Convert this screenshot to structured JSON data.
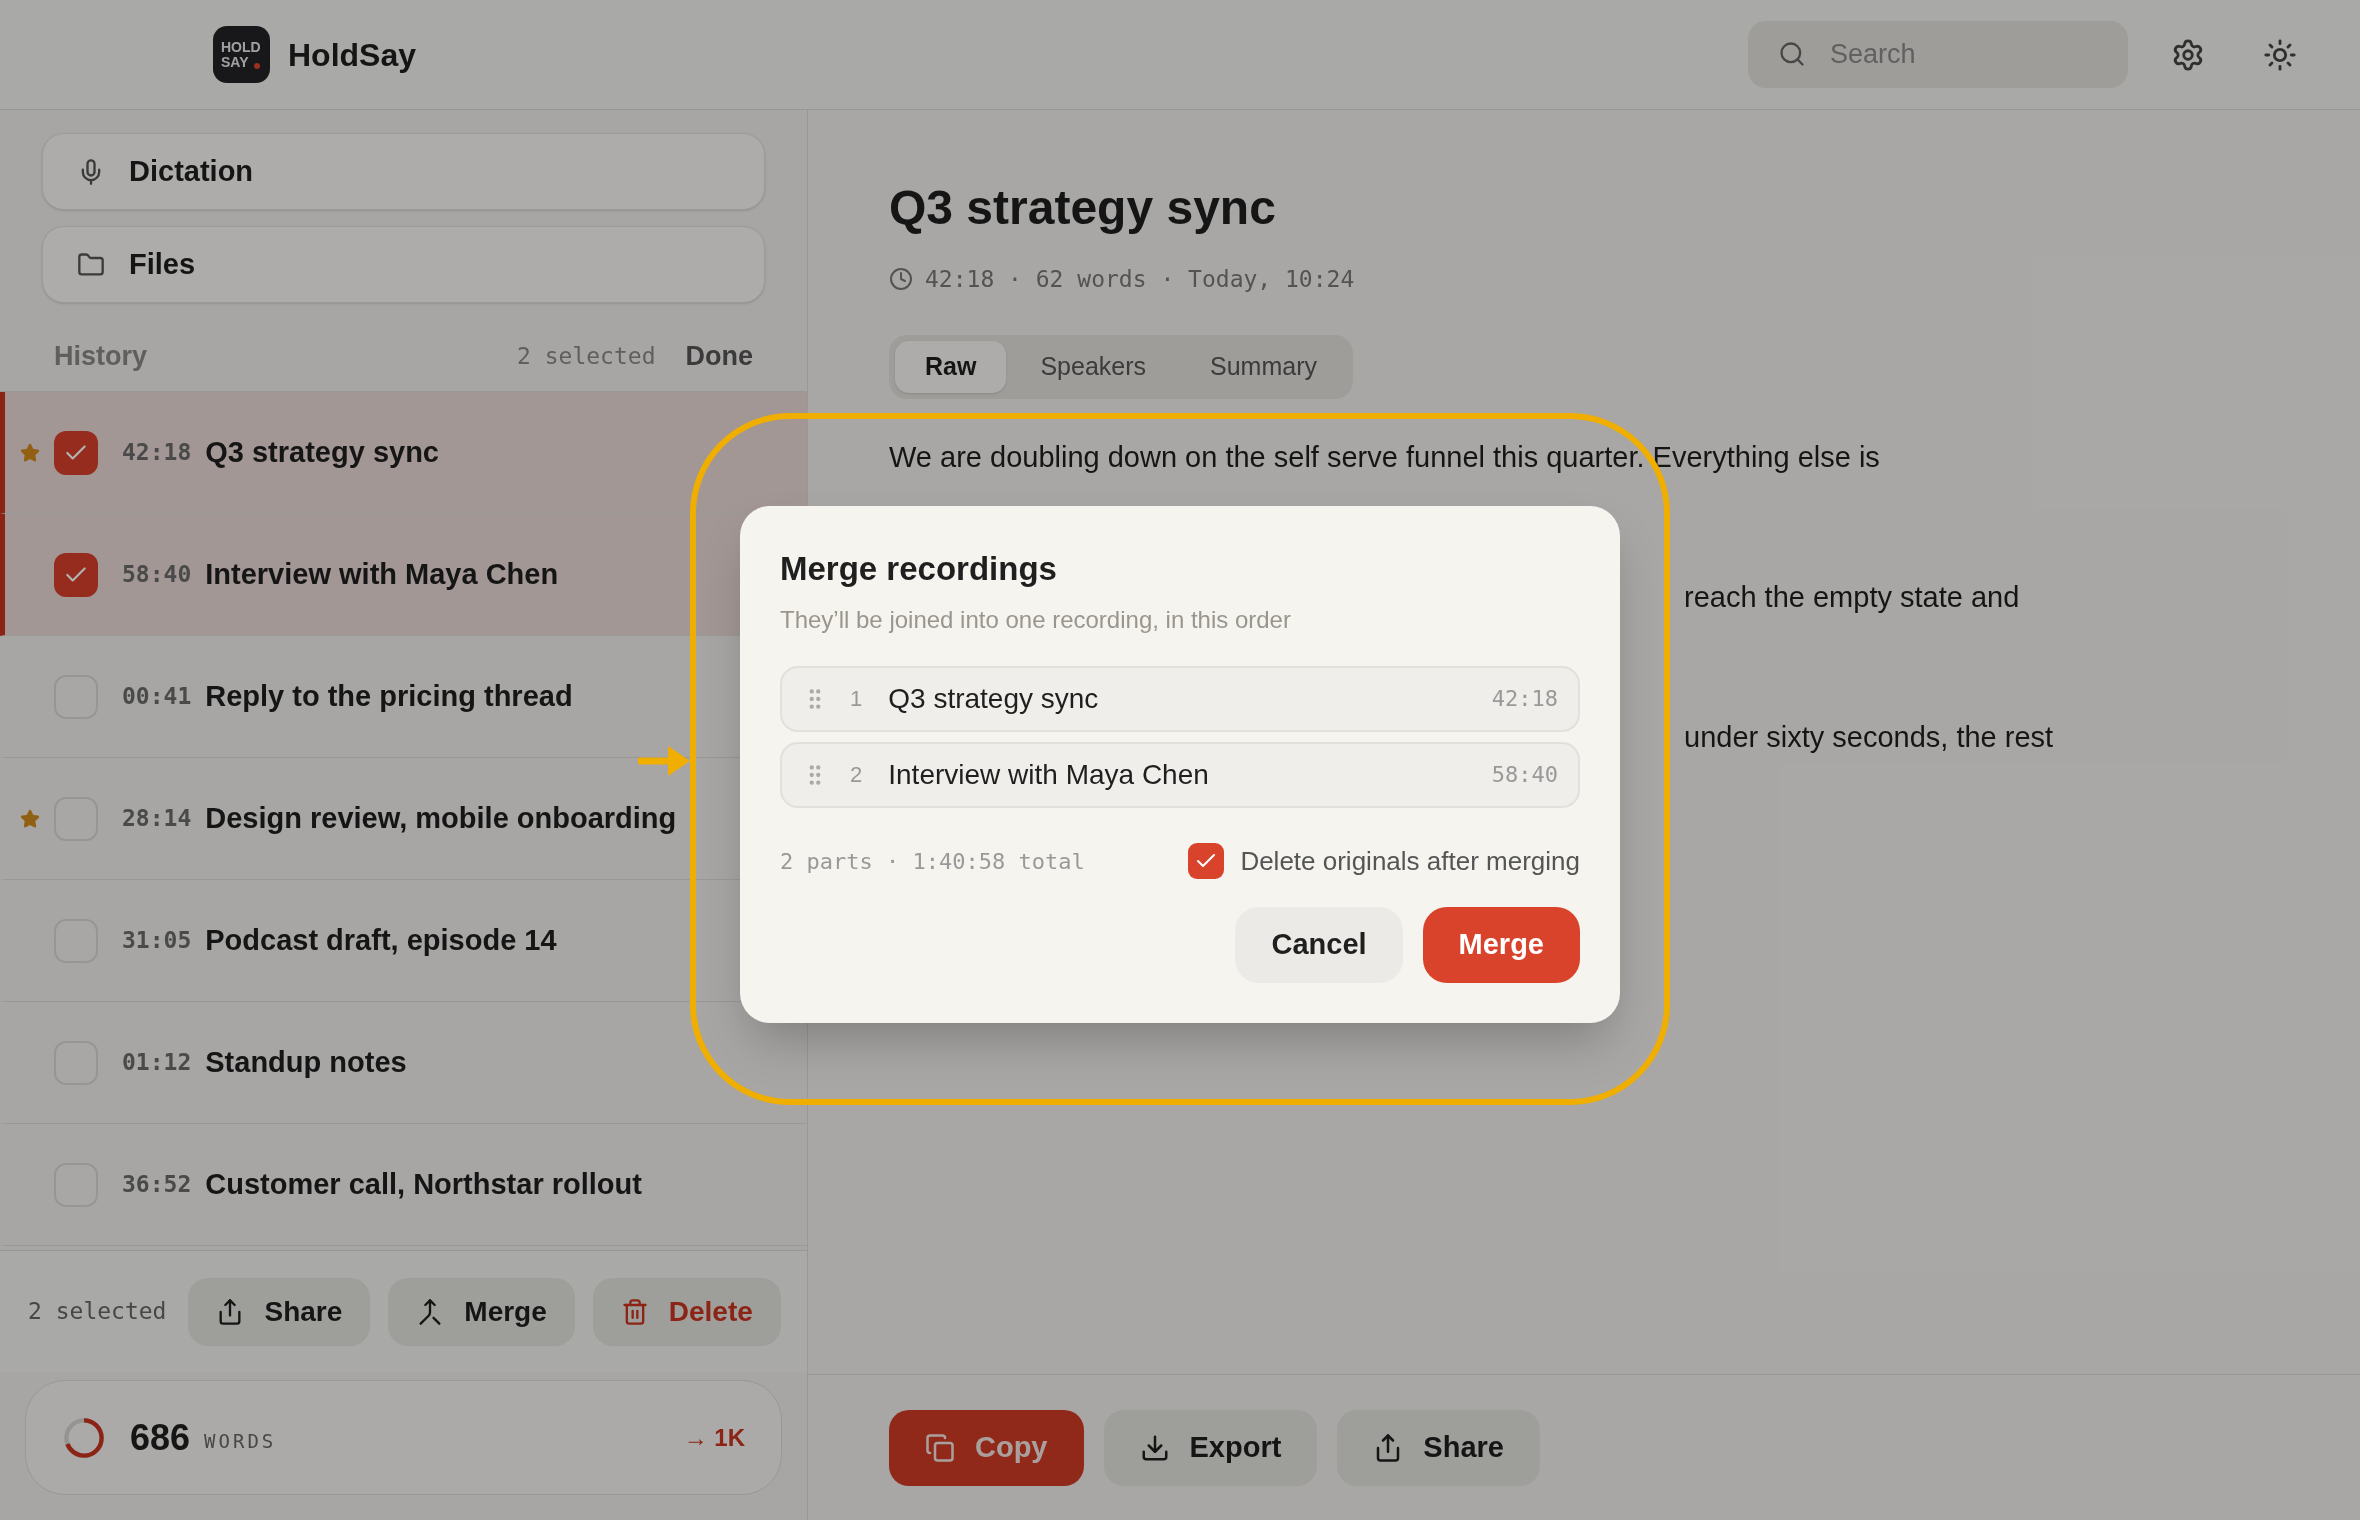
{
  "app": {
    "logo_lines": [
      "HOLD",
      "SAY"
    ],
    "name": "HoldSay"
  },
  "search": {
    "placeholder": "Search"
  },
  "sidebar": {
    "nav": [
      {
        "label": "Dictation",
        "kind": "mic"
      },
      {
        "label": "Files",
        "kind": "folder"
      }
    ],
    "history": {
      "title": "History",
      "selected_count": "2 selected",
      "done": "Done"
    },
    "recordings": [
      {
        "duration": "42:18",
        "title": "Q3 strategy sync",
        "checked": true,
        "starred": true
      },
      {
        "duration": "58:40",
        "title": "Interview with Maya Chen",
        "checked": true,
        "starred": false
      },
      {
        "duration": "00:41",
        "title": "Reply to the pricing thread",
        "checked": false,
        "starred": false
      },
      {
        "duration": "28:14",
        "title": "Design review, mobile onboarding",
        "checked": false,
        "starred": true
      },
      {
        "duration": "31:05",
        "title": "Podcast draft, episode 14",
        "checked": false,
        "starred": false
      },
      {
        "duration": "01:12",
        "title": "Standup notes",
        "checked": false,
        "starred": false
      },
      {
        "duration": "36:52",
        "title": "Customer call, Northstar rollout",
        "checked": false,
        "starred": false
      }
    ],
    "selection_bar": {
      "count": "2 selected",
      "actions": [
        {
          "label": "Share",
          "kind": "share"
        },
        {
          "label": "Merge",
          "kind": "merge"
        },
        {
          "label": "Delete",
          "kind": "delete"
        }
      ]
    },
    "word_goal": {
      "count": "686",
      "unit": "WORDS",
      "goal": "→ 1K",
      "level": 0.69
    }
  },
  "document": {
    "title": "Q3 strategy sync",
    "meta": "42:18 · 62 words · Today, 10:24",
    "tabs": [
      {
        "label": "Raw",
        "selected": true
      },
      {
        "label": "Speakers",
        "selected": false
      },
      {
        "label": "Summary",
        "selected": false
      }
    ],
    "paragraphs": [
      "We are doubling down on the self serve funnel this quarter. Everything else is",
      "reach the empty state and",
      "under sixty seconds, the rest"
    ],
    "actions": [
      {
        "label": "Copy",
        "kind": "copy"
      },
      {
        "label": "Export",
        "kind": "export"
      },
      {
        "label": "Share",
        "kind": "share"
      }
    ]
  },
  "dialog": {
    "title": "Merge recordings",
    "subtitle": "They’ll be joined into one recording, in this order",
    "parts": [
      {
        "index": "1",
        "title": "Q3 strategy sync",
        "duration": "42:18"
      },
      {
        "index": "2",
        "title": "Interview with Maya Chen",
        "duration": "58:40"
      }
    ],
    "summary": "2 parts · 1:40:58 total",
    "delete_originals": {
      "label": "Delete originals after merging",
      "checked": true
    },
    "buttons": [
      {
        "label": "Cancel",
        "kind": "secondary"
      },
      {
        "label": "Merge",
        "kind": "primary"
      }
    ]
  }
}
